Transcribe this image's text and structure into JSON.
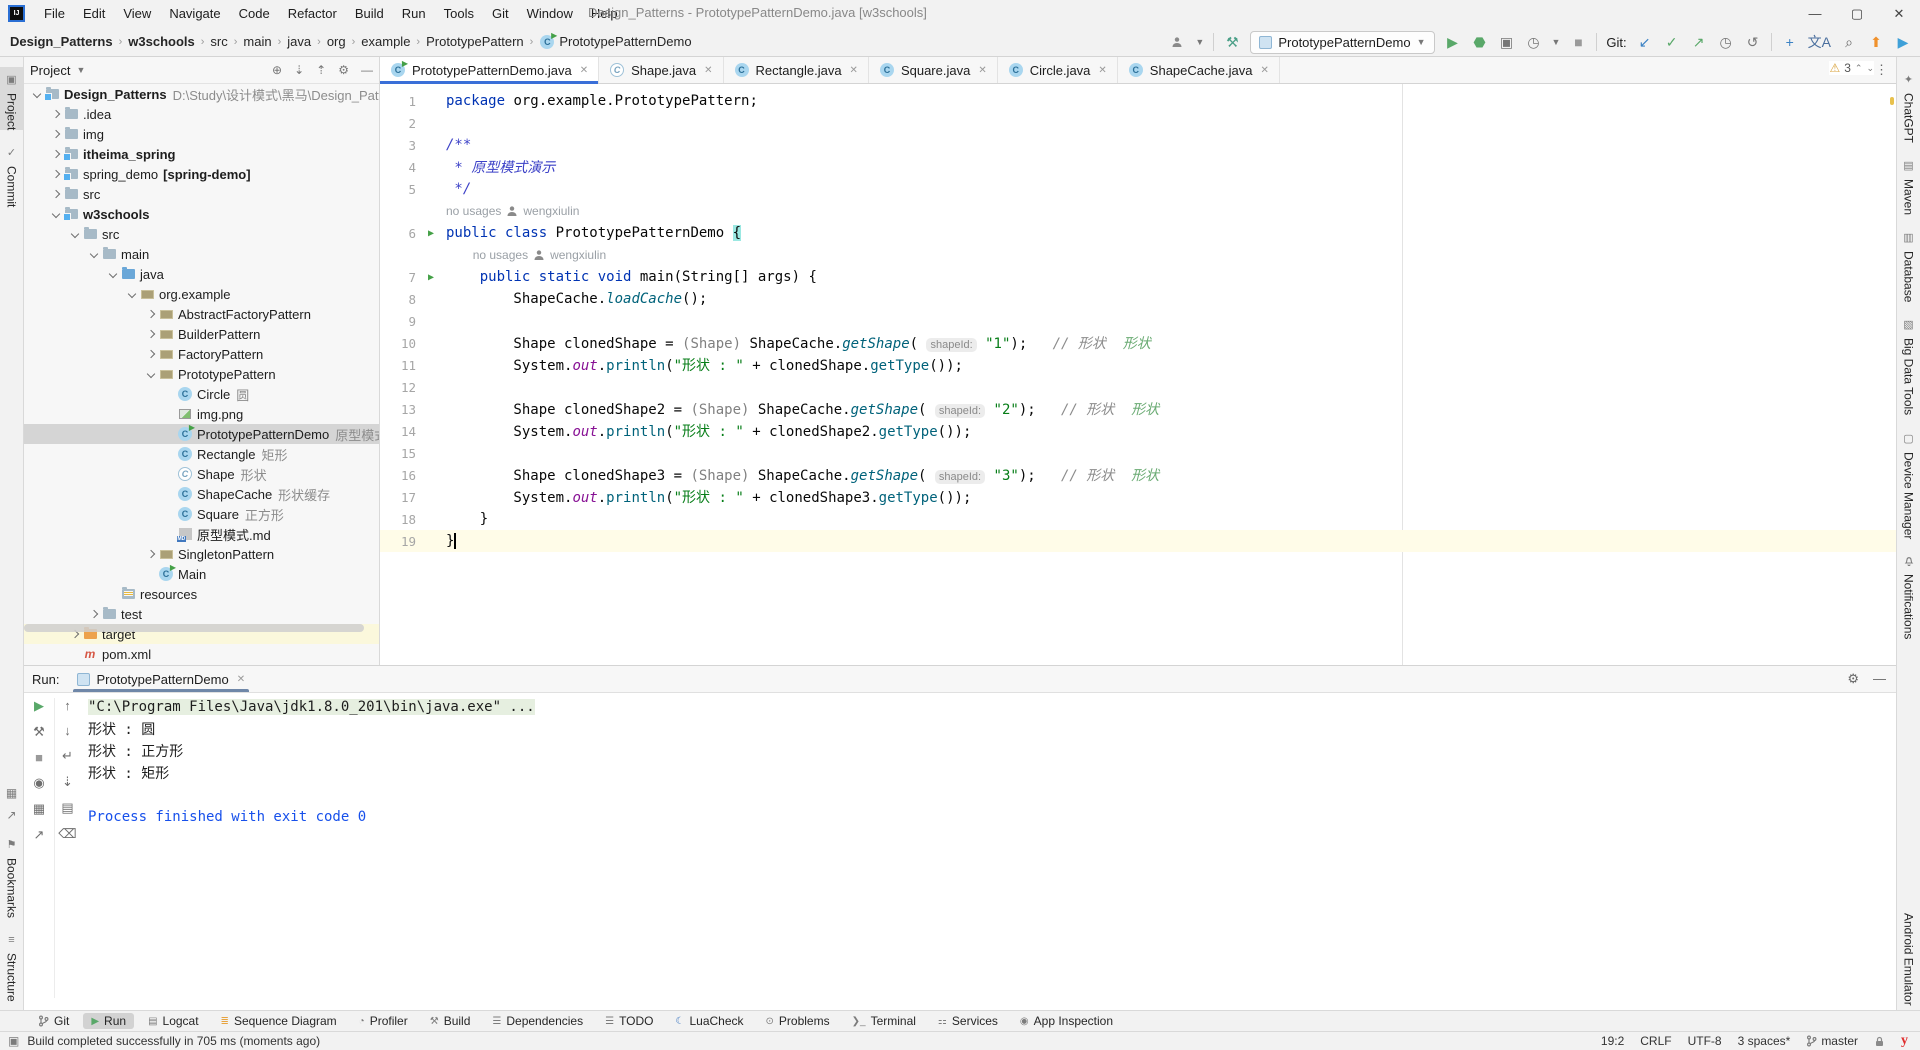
{
  "window": {
    "title": "Design_Patterns - PrototypePatternDemo.java [w3schools]",
    "menu": [
      "File",
      "Edit",
      "View",
      "Navigate",
      "Code",
      "Refactor",
      "Build",
      "Run",
      "Tools",
      "Git",
      "Window",
      "Help"
    ],
    "controls": [
      "minimize",
      "maximize",
      "close"
    ]
  },
  "breadcrumb": {
    "items": [
      {
        "label": "Design_Patterns",
        "bold": true
      },
      {
        "label": "w3schools",
        "bold": true
      },
      {
        "label": "src",
        "bold": false
      },
      {
        "label": "main",
        "bold": false
      },
      {
        "label": "java",
        "bold": false
      },
      {
        "label": "org",
        "bold": false
      },
      {
        "label": "example",
        "bold": false
      },
      {
        "label": "PrototypePattern",
        "bold": false
      },
      {
        "label": "PrototypePatternDemo",
        "bold": false,
        "icon": "class-run"
      }
    ]
  },
  "toolbar": {
    "run_config": "PrototypePatternDemo",
    "git_label": "Git:",
    "icons_left": [
      {
        "name": "user-dropdown-icon",
        "glyph": "person",
        "color": "#6e6e6e",
        "dd": true
      },
      {
        "name": "separator"
      },
      {
        "name": "build-hammer-icon",
        "glyph": "⚒",
        "color": "#4a9f87"
      }
    ],
    "icons_right": [
      {
        "name": "run-button",
        "glyph": "▶",
        "color": "#59a869"
      },
      {
        "name": "debug-button",
        "glyph": "⬣",
        "color": "#59a869"
      },
      {
        "name": "coverage-button",
        "glyph": "▣",
        "color": "#777777"
      },
      {
        "name": "profiler-button",
        "glyph": "◷",
        "color": "#777777",
        "dd": true
      },
      {
        "name": "stop-button",
        "glyph": "■",
        "color": "#9a9a9a"
      },
      {
        "name": "separator"
      },
      {
        "name": "git-label"
      },
      {
        "name": "git-update-button",
        "glyph": "↙",
        "color": "#3b82c4"
      },
      {
        "name": "git-commit-button",
        "glyph": "✓",
        "color": "#59a869"
      },
      {
        "name": "git-push-button",
        "glyph": "↗",
        "color": "#59a869"
      },
      {
        "name": "git-history-button",
        "glyph": "◷",
        "color": "#777777"
      },
      {
        "name": "git-rollback-button",
        "glyph": "↺",
        "color": "#777777"
      },
      {
        "name": "separator"
      },
      {
        "name": "plus-plugin-button",
        "glyph": "+",
        "color": "#3b82c4"
      },
      {
        "name": "translate-button",
        "glyph": "文A",
        "color": "#4a6f9e"
      },
      {
        "name": "search-everywhere-button",
        "glyph": "⌕",
        "color": "#666666"
      },
      {
        "name": "update-plugin-button",
        "glyph": "⬆",
        "color": "#f0912c"
      },
      {
        "name": "colorful-plugin-button",
        "glyph": "▶",
        "color": "#3fa0d8"
      }
    ]
  },
  "left_stripe": {
    "top": [
      {
        "label": "Project",
        "icon": "▣",
        "selected": true
      },
      {
        "label": "Commit",
        "icon": "✓",
        "selected": false
      }
    ],
    "bottom_icons": [
      "▦",
      "↗"
    ],
    "bottom": [
      {
        "label": "Bookmarks",
        "icon": "⚑"
      },
      {
        "label": "Structure",
        "icon": "≡"
      }
    ]
  },
  "right_stripe": {
    "top": [
      {
        "label": "ChatGPT",
        "icon": "✦"
      },
      {
        "label": "Maven",
        "icon": "▤"
      },
      {
        "label": "Database",
        "icon": "▥"
      },
      {
        "label": "Big Data Tools",
        "icon": "▧"
      },
      {
        "label": "Device Manager",
        "icon": "▢"
      },
      {
        "label": "Notifications",
        "icon": "bell"
      }
    ],
    "bottom": [
      {
        "label": "Android Emulator",
        "icon": "▣"
      }
    ]
  },
  "project_panel": {
    "header": "Project",
    "header_icons": [
      "⊕",
      "⇣",
      "⇡",
      "⚙",
      "—"
    ],
    "tree": [
      {
        "label": "Design_Patterns",
        "bold": true,
        "hint": "D:\\Study\\设计模式\\黑马\\Design_Patte",
        "depth": 0,
        "arrow": "d",
        "icon": "folder-module"
      },
      {
        "label": ".idea",
        "depth": 1,
        "arrow": "r",
        "icon": "folder"
      },
      {
        "label": "img",
        "depth": 1,
        "arrow": "r",
        "icon": "folder"
      },
      {
        "label": "itheima_spring",
        "bold": true,
        "depth": 1,
        "arrow": "r",
        "icon": "folder-module"
      },
      {
        "label": "spring_demo",
        "suffix": "[spring-demo]",
        "depth": 1,
        "arrow": "r",
        "icon": "folder-module"
      },
      {
        "label": "src",
        "depth": 1,
        "arrow": "r",
        "icon": "folder"
      },
      {
        "label": "w3schools",
        "bold": true,
        "depth": 1,
        "arrow": "d",
        "icon": "folder-module"
      },
      {
        "label": "src",
        "depth": 2,
        "arrow": "d",
        "icon": "folder"
      },
      {
        "label": "main",
        "depth": 3,
        "arrow": "d",
        "icon": "folder"
      },
      {
        "label": "java",
        "depth": 4,
        "arrow": "d",
        "icon": "folder-java"
      },
      {
        "label": "org.example",
        "depth": 5,
        "arrow": "d",
        "icon": "package"
      },
      {
        "label": "AbstractFactoryPattern",
        "depth": 6,
        "arrow": "r",
        "icon": "package"
      },
      {
        "label": "BuilderPattern",
        "depth": 6,
        "arrow": "r",
        "icon": "package"
      },
      {
        "label": "FactoryPattern",
        "depth": 6,
        "arrow": "r",
        "icon": "package"
      },
      {
        "label": "PrototypePattern",
        "depth": 6,
        "arrow": "d",
        "icon": "package"
      },
      {
        "label": "Circle",
        "hint": "圆",
        "depth": 7,
        "icon": "class"
      },
      {
        "label": "img.png",
        "depth": 7,
        "icon": "image"
      },
      {
        "label": "PrototypePatternDemo",
        "hint": "原型模式演示",
        "depth": 7,
        "icon": "class-run",
        "selected": true
      },
      {
        "label": "Rectangle",
        "hint": "矩形",
        "depth": 7,
        "icon": "class"
      },
      {
        "label": "Shape",
        "hint": "形状",
        "depth": 7,
        "icon": "class-abstract"
      },
      {
        "label": "ShapeCache",
        "hint": "形状缓存",
        "depth": 7,
        "icon": "class"
      },
      {
        "label": "Square",
        "hint": "正方形",
        "depth": 7,
        "icon": "class"
      },
      {
        "label": "原型模式.md",
        "depth": 7,
        "icon": "md"
      },
      {
        "label": "SingletonPattern",
        "depth": 6,
        "arrow": "r",
        "icon": "package"
      },
      {
        "label": "Main",
        "depth": 6,
        "icon": "class-run"
      },
      {
        "label": "resources",
        "depth": 4,
        "icon": "folder-res"
      },
      {
        "label": "test",
        "depth": 3,
        "arrow": "r",
        "icon": "folder"
      },
      {
        "label": "target",
        "depth": 2,
        "arrow": "r",
        "icon": "folder-target",
        "highlight": true
      },
      {
        "label": "pom.xml",
        "depth": 2,
        "icon": "maven"
      }
    ]
  },
  "editor": {
    "tabs": [
      {
        "label": "PrototypePatternDemo.java",
        "icon": "class-run",
        "active": true
      },
      {
        "label": "Shape.java",
        "icon": "class-abstract",
        "active": false
      },
      {
        "label": "Rectangle.java",
        "icon": "class",
        "active": false
      },
      {
        "label": "Square.java",
        "icon": "class",
        "active": false
      },
      {
        "label": "Circle.java",
        "icon": "class",
        "active": false
      },
      {
        "label": "ShapeCache.java",
        "icon": "class",
        "active": false
      }
    ],
    "inspection": {
      "warning_count": "3"
    },
    "rows": [
      {
        "n": "1",
        "seg": [
          [
            "kw",
            "package"
          ],
          [
            "pl",
            " org.example.PrototypePattern;"
          ]
        ]
      },
      {
        "n": "2",
        "seg": []
      },
      {
        "n": "3",
        "seg": [
          [
            "doc",
            "/**"
          ]
        ]
      },
      {
        "n": "4",
        "seg": [
          [
            "doc",
            " * 原型模式演示"
          ]
        ]
      },
      {
        "n": "5",
        "seg": [
          [
            "doc",
            " */"
          ]
        ]
      },
      {
        "type": "inlay",
        "indent": 0,
        "usages": "no usages",
        "author": "wengxiulin"
      },
      {
        "n": "6",
        "run": true,
        "seg": [
          [
            "kw",
            "public class"
          ],
          [
            "pl",
            " PrototypePatternDemo "
          ],
          [
            "hl",
            "{"
          ]
        ]
      },
      {
        "type": "inlay",
        "indent": 4,
        "usages": "no usages",
        "author": "wengxiulin"
      },
      {
        "n": "7",
        "run": true,
        "seg": [
          [
            "kw",
            "    public static void"
          ],
          [
            "pl",
            " main(String[] args) {"
          ]
        ]
      },
      {
        "n": "8",
        "seg": [
          [
            "pl",
            "        ShapeCache."
          ],
          [
            "smeth",
            "loadCache"
          ],
          [
            "pl",
            "();"
          ]
        ]
      },
      {
        "n": "9",
        "seg": []
      },
      {
        "n": "10",
        "seg": [
          [
            "pl",
            "        Shape clonedShape = "
          ],
          [
            "gray",
            "(Shape)"
          ],
          [
            "pl",
            " ShapeCache."
          ],
          [
            "smeth",
            "getShape"
          ],
          [
            "pl",
            "( "
          ],
          [
            "hint",
            "shapeId:"
          ],
          [
            "pl",
            " "
          ],
          [
            "str",
            "\"1\""
          ],
          [
            "pl",
            ");   "
          ],
          [
            "cmt",
            "// 形状"
          ],
          [
            "pl",
            "  "
          ],
          [
            "cmt2",
            "形状"
          ]
        ]
      },
      {
        "n": "11",
        "seg": [
          [
            "pl",
            "        System."
          ],
          [
            "field",
            "out"
          ],
          [
            "pl",
            "."
          ],
          [
            "meth",
            "println"
          ],
          [
            "pl",
            "("
          ],
          [
            "str",
            "\"形状 : \""
          ],
          [
            "pl",
            " + clonedShape."
          ],
          [
            "meth",
            "getType"
          ],
          [
            "pl",
            "());"
          ]
        ]
      },
      {
        "n": "12",
        "seg": []
      },
      {
        "n": "13",
        "seg": [
          [
            "pl",
            "        Shape clonedShape2 = "
          ],
          [
            "gray",
            "(Shape)"
          ],
          [
            "pl",
            " ShapeCache."
          ],
          [
            "smeth",
            "getShape"
          ],
          [
            "pl",
            "( "
          ],
          [
            "hint",
            "shapeId:"
          ],
          [
            "pl",
            " "
          ],
          [
            "str",
            "\"2\""
          ],
          [
            "pl",
            ");   "
          ],
          [
            "cmt",
            "// 形状"
          ],
          [
            "pl",
            "  "
          ],
          [
            "cmt2",
            "形状"
          ]
        ]
      },
      {
        "n": "14",
        "seg": [
          [
            "pl",
            "        System."
          ],
          [
            "field",
            "out"
          ],
          [
            "pl",
            "."
          ],
          [
            "meth",
            "println"
          ],
          [
            "pl",
            "("
          ],
          [
            "str",
            "\"形状 : \""
          ],
          [
            "pl",
            " + clonedShape2."
          ],
          [
            "meth",
            "getType"
          ],
          [
            "pl",
            "());"
          ]
        ]
      },
      {
        "n": "15",
        "seg": []
      },
      {
        "n": "16",
        "seg": [
          [
            "pl",
            "        Shape clonedShape3 = "
          ],
          [
            "gray",
            "(Shape)"
          ],
          [
            "pl",
            " ShapeCache."
          ],
          [
            "smeth",
            "getShape"
          ],
          [
            "pl",
            "( "
          ],
          [
            "hint",
            "shapeId:"
          ],
          [
            "pl",
            " "
          ],
          [
            "str",
            "\"3\""
          ],
          [
            "pl",
            ");   "
          ],
          [
            "cmt",
            "// 形状"
          ],
          [
            "pl",
            "  "
          ],
          [
            "cmt2",
            "形状"
          ]
        ]
      },
      {
        "n": "17",
        "seg": [
          [
            "pl",
            "        System."
          ],
          [
            "field",
            "out"
          ],
          [
            "pl",
            "."
          ],
          [
            "meth",
            "println"
          ],
          [
            "pl",
            "("
          ],
          [
            "str",
            "\"形状 : \""
          ],
          [
            "pl",
            " + clonedShape3."
          ],
          [
            "meth",
            "getType"
          ],
          [
            "pl",
            "());"
          ]
        ]
      },
      {
        "n": "18",
        "seg": [
          [
            "pl",
            "    }"
          ]
        ]
      },
      {
        "n": "19",
        "current": true,
        "caret": true,
        "seg": [
          [
            "pl",
            "}"
          ]
        ]
      }
    ]
  },
  "run_panel": {
    "label": "Run:",
    "tab": "PrototypePatternDemo",
    "toolbar_col1": [
      {
        "name": "rerun-button",
        "glyph": "▶",
        "color": "#59a869"
      },
      {
        "name": "run-settings-button",
        "glyph": "⚒",
        "color": "#6e6e6e"
      },
      {
        "name": "stop-button",
        "glyph": "■",
        "color": "#9a9a9a"
      },
      {
        "name": "screenshot-button",
        "glyph": "◉",
        "color": "#6e6e6e"
      },
      {
        "name": "restore-layout-button",
        "glyph": "▦",
        "color": "#6e6e6e"
      },
      {
        "name": "pin-button",
        "glyph": "↗",
        "color": "#6e6e6e"
      }
    ],
    "toolbar_col2": [
      {
        "name": "up-stack-button",
        "glyph": "↑",
        "color": "#6e6e6e"
      },
      {
        "name": "down-stack-button",
        "glyph": "↓",
        "color": "#6e6e6e"
      },
      {
        "name": "soft-wrap-button",
        "glyph": "↵",
        "color": "#6e6e6e"
      },
      {
        "name": "scroll-to-end-button",
        "glyph": "⇣",
        "color": "#6e6e6e"
      },
      {
        "name": "print-button",
        "glyph": "▤",
        "color": "#6e6e6e"
      },
      {
        "name": "clear-all-button",
        "glyph": "⌫",
        "color": "#6e6e6e"
      }
    ],
    "console": [
      {
        "style": "cmd",
        "text": "\"C:\\Program Files\\Java\\jdk1.8.0_201\\bin\\java.exe\" ..."
      },
      {
        "style": "plain",
        "text": "形状 : 圆"
      },
      {
        "style": "plain",
        "text": "形状 : 正方形"
      },
      {
        "style": "plain",
        "text": "形状 : 矩形"
      },
      {
        "style": "plain",
        "text": ""
      },
      {
        "style": "blue",
        "text": "Process finished with exit code 0"
      }
    ]
  },
  "bottom_bar": {
    "items": [
      {
        "label": "Git",
        "icon": "branch",
        "selected": false
      },
      {
        "label": "Run",
        "icon": "play",
        "selected": true
      },
      {
        "label": "Logcat",
        "icon": "▤",
        "selected": false
      },
      {
        "label": "Sequence Diagram",
        "icon": "≣",
        "selected": false,
        "icon_color": "#e8a33d"
      },
      {
        "label": "Profiler",
        "icon": "◔",
        "selected": false
      },
      {
        "label": "Build",
        "icon": "⚒",
        "selected": false
      },
      {
        "label": "Dependencies",
        "icon": "☰",
        "selected": false
      },
      {
        "label": "TODO",
        "icon": "☰",
        "selected": false
      },
      {
        "label": "LuaCheck",
        "icon": "☾",
        "selected": false,
        "icon_color": "#3b76c0"
      },
      {
        "label": "Problems",
        "icon": "⊙",
        "selected": false
      },
      {
        "label": "Terminal",
        "icon": "❯_",
        "selected": false
      },
      {
        "label": "Services",
        "icon": "⚏",
        "selected": false
      },
      {
        "label": "App Inspection",
        "icon": "◉",
        "selected": false
      }
    ]
  },
  "status_bar": {
    "message": "Build completed successfully in 705 ms (moments ago)",
    "right": [
      {
        "name": "caret-position",
        "label": "19:2"
      },
      {
        "name": "line-separator",
        "label": "CRLF"
      },
      {
        "name": "encoding",
        "label": "UTF-8"
      },
      {
        "name": "indent",
        "label": "3 spaces*"
      },
      {
        "name": "git-branch",
        "label": "master",
        "icon": "branch"
      },
      {
        "name": "lock-icon",
        "label": "",
        "icon": "lock"
      },
      {
        "name": "plugin-y-icon",
        "label": "y"
      }
    ]
  }
}
